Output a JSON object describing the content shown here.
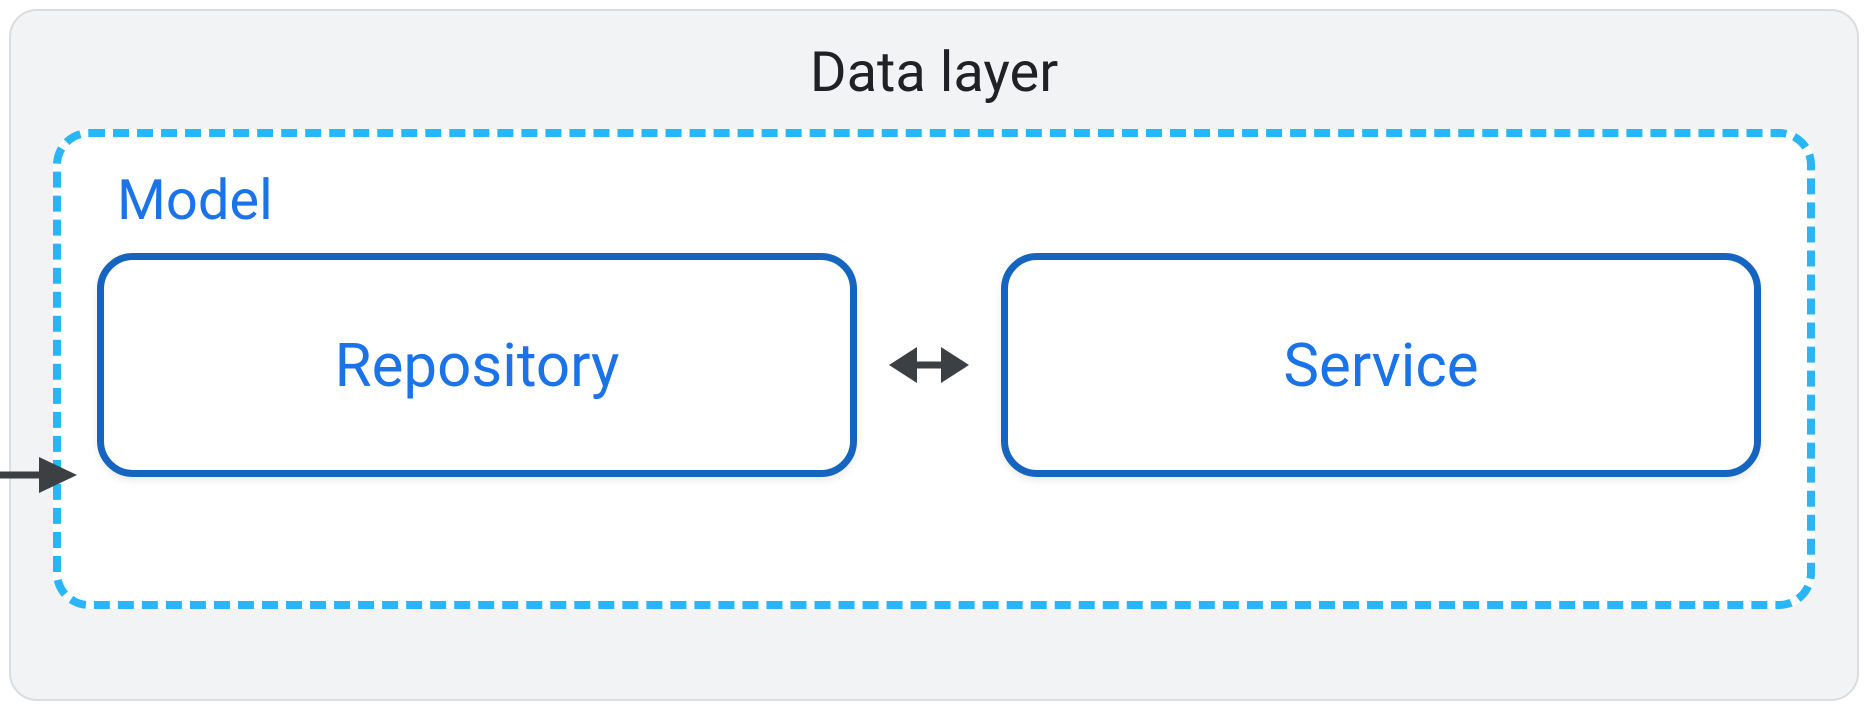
{
  "diagram": {
    "title": "Data layer",
    "model": {
      "label": "Model",
      "components": [
        {
          "name": "Repository"
        },
        {
          "name": "Service"
        }
      ]
    }
  }
}
